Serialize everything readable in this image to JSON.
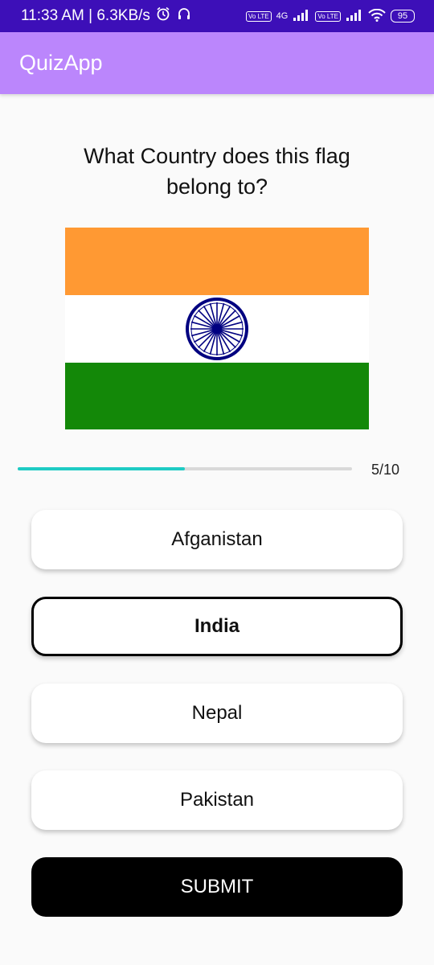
{
  "status_bar": {
    "time_speed": "11:33 AM | 6.3KB/s",
    "sim1_badge": "Vo LTE",
    "network_label": "4G",
    "sim2_badge": "Vo LTE",
    "battery": "95",
    "icons": [
      "alarm-icon",
      "headphones-icon",
      "signal-icon",
      "wifi-icon",
      "battery-icon"
    ]
  },
  "app_bar": {
    "title": "QuizApp",
    "color": "#bb86fc"
  },
  "question": {
    "text": "What Country does this flag belong to?"
  },
  "flag": {
    "colors": {
      "saffron": "#ff9933",
      "white": "#ffffff",
      "green": "#138808",
      "chakra": "#000080"
    }
  },
  "progress": {
    "current": 5,
    "total": 10,
    "text": "5/10",
    "fill_color": "#1ecbc4"
  },
  "options": [
    {
      "label": "Afganistan",
      "selected": false
    },
    {
      "label": "India",
      "selected": true
    },
    {
      "label": "Nepal",
      "selected": false
    },
    {
      "label": "Pakistan",
      "selected": false
    }
  ],
  "submit": {
    "label": "SUBMIT"
  }
}
